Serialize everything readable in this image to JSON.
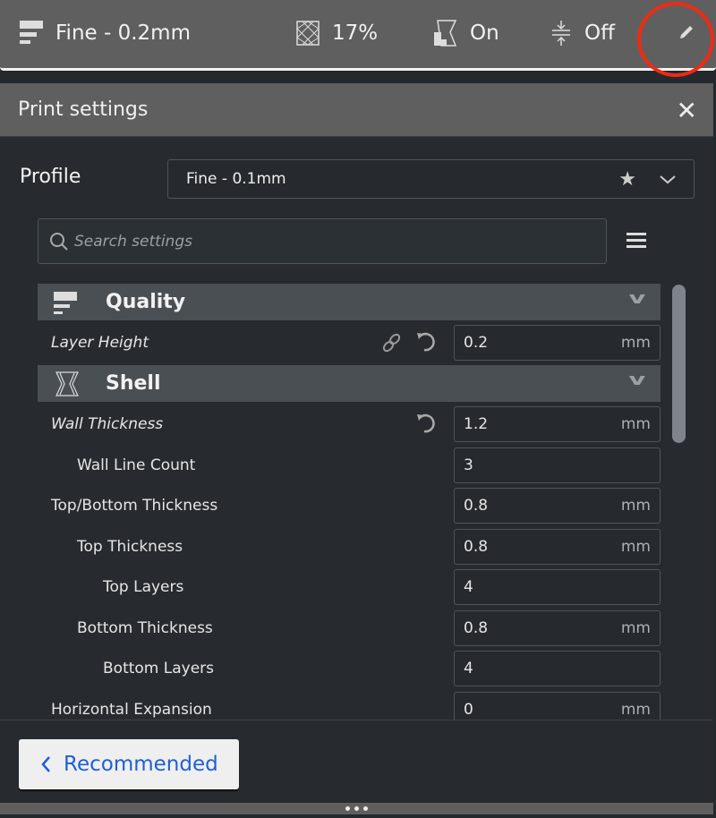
{
  "topbar": {
    "profile": "Fine - 0.2mm",
    "infill": "17%",
    "support": "On",
    "adhesion": "Off",
    "icons": [
      "layers-icon",
      "infill-icon",
      "support-icon",
      "adhesion-icon",
      "pencil-icon"
    ]
  },
  "panel": {
    "title": "Print settings",
    "profile_label": "Profile",
    "profile_value": "Fine - 0.1mm",
    "search_placeholder": "Search settings"
  },
  "categories": [
    {
      "label": "Quality"
    },
    {
      "label": "Shell"
    }
  ],
  "rows": [
    {
      "label": "Layer Height",
      "value": "0.2",
      "unit": "mm"
    },
    {
      "label": "Wall Thickness",
      "value": "1.2",
      "unit": "mm"
    },
    {
      "label": "Wall Line Count",
      "value": "3",
      "unit": ""
    },
    {
      "label": "Top/Bottom Thickness",
      "value": "0.8",
      "unit": "mm"
    },
    {
      "label": "Top Thickness",
      "value": "0.8",
      "unit": "mm"
    },
    {
      "label": "Top Layers",
      "value": "4",
      "unit": ""
    },
    {
      "label": "Bottom Thickness",
      "value": "0.8",
      "unit": "mm"
    },
    {
      "label": "Bottom Layers",
      "value": "4",
      "unit": ""
    },
    {
      "label": "Horizontal Expansion",
      "value": "0",
      "unit": "mm"
    }
  ],
  "footer": {
    "recommended": "Recommended"
  },
  "colors": {
    "accent": "#1f5fd6",
    "highlight": "#f02a13"
  }
}
